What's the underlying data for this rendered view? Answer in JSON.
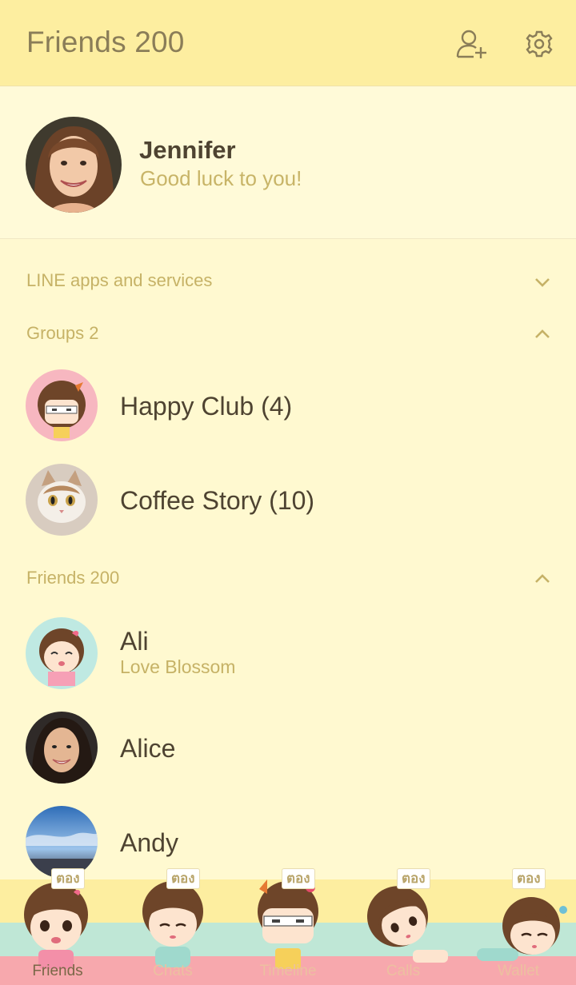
{
  "header": {
    "title": "Friends 200",
    "add_friend_icon": "add-friend-icon",
    "settings_icon": "gear-icon"
  },
  "profile": {
    "name": "Jennifer",
    "status": "Good luck to you!"
  },
  "sections": {
    "services": {
      "title": "LINE apps and services",
      "state": "collapsed"
    },
    "groups": {
      "title": "Groups 2",
      "state": "expanded"
    },
    "friends": {
      "title": "Friends 200",
      "state": "expanded"
    }
  },
  "groups": [
    {
      "name": "Happy Club (4)"
    },
    {
      "name": "Coffee Story (10)"
    }
  ],
  "friends": [
    {
      "name": "Ali",
      "status": "Love Blossom"
    },
    {
      "name": "Alice",
      "status": ""
    },
    {
      "name": "Andy",
      "status": ""
    }
  ],
  "tabs": [
    {
      "label": "Friends",
      "badge": "ตอง",
      "active": true
    },
    {
      "label": "Chats",
      "badge": "ตอง",
      "active": false
    },
    {
      "label": "Timeline",
      "badge": "ตอง",
      "active": false
    },
    {
      "label": "Calls",
      "badge": "ตอง",
      "active": false
    },
    {
      "label": "Wallet",
      "badge": "ตอง",
      "active": false
    }
  ],
  "colors": {
    "header_bg": "#fdeea0",
    "page_bg": "#fff9d0",
    "accent_text": "#c6b266",
    "primary_text": "#4e4331",
    "tab_green": "#bfe7d6",
    "tab_pink": "#f7a8ad"
  }
}
